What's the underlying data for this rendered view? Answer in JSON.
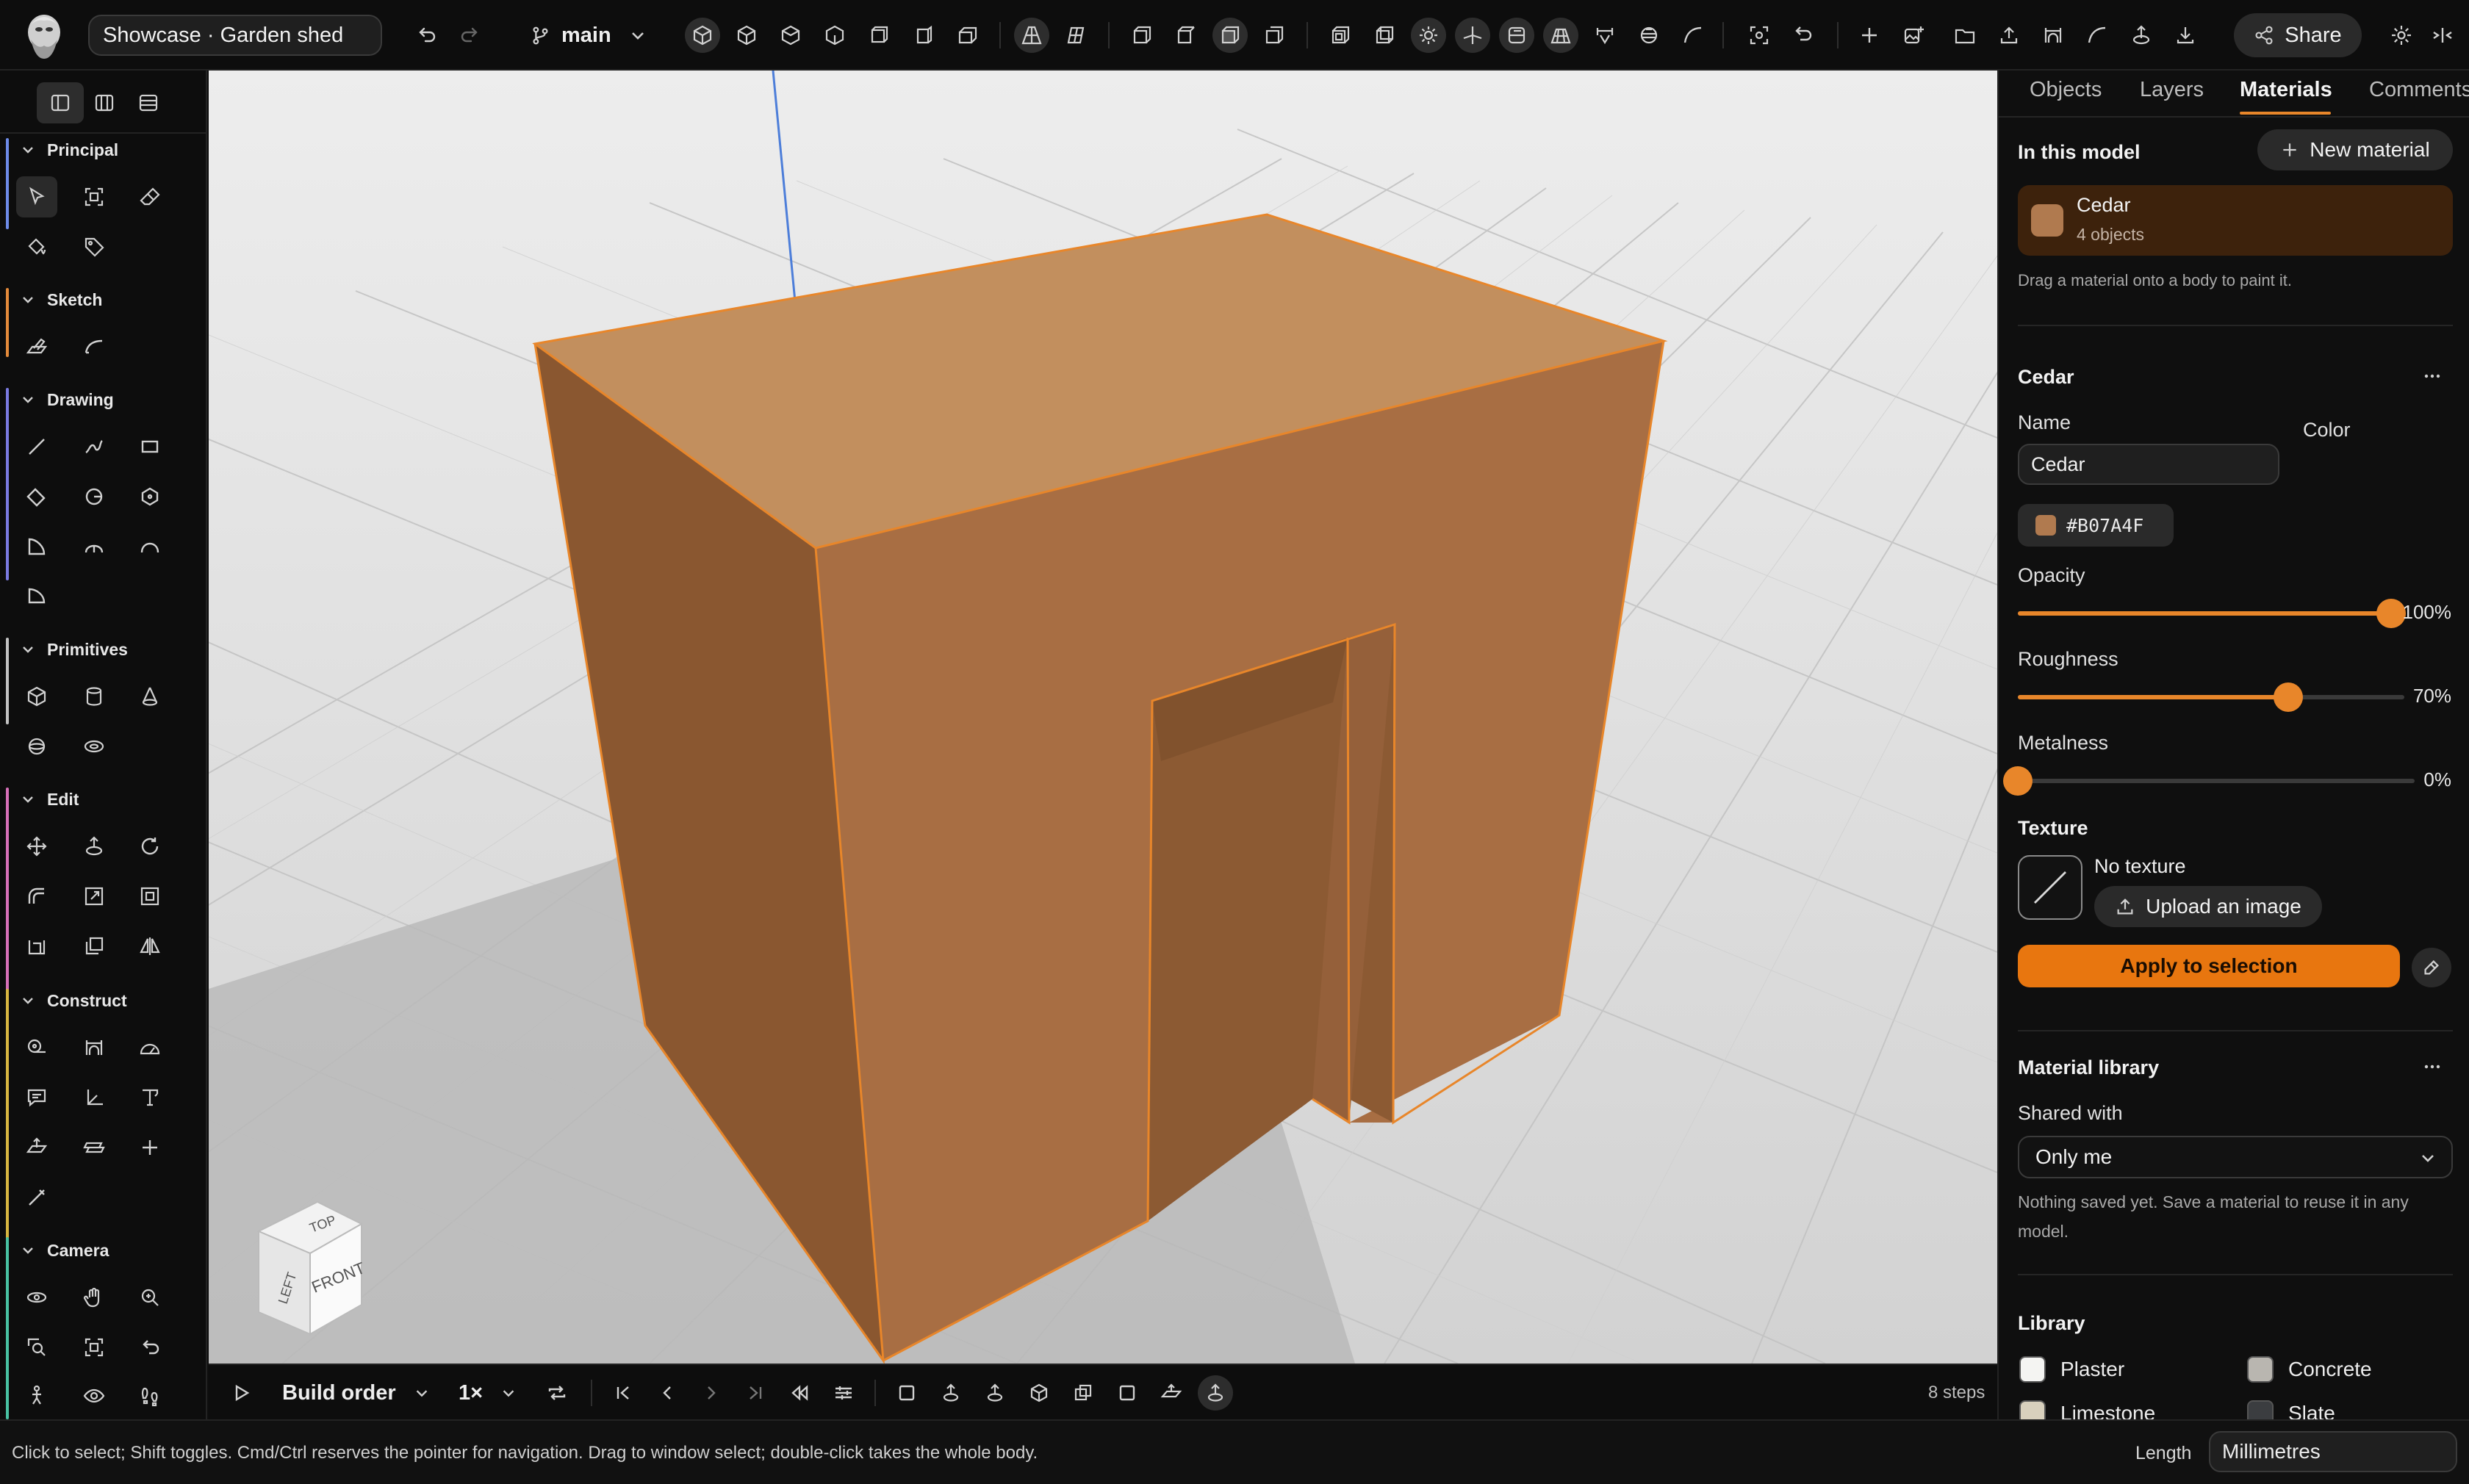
{
  "project": {
    "name": "Showcase · Garden shed"
  },
  "branch": {
    "name": "main"
  },
  "share": {
    "label": "Share"
  },
  "left_sections": {
    "principal": "Principal",
    "sketch": "Sketch",
    "drawing": "Drawing",
    "primitives": "Primitives",
    "edit": "Edit",
    "construct": "Construct",
    "camera": "Camera"
  },
  "viewcube": {
    "top": "TOP",
    "front": "FRONT",
    "left": "LEFT"
  },
  "timeline": {
    "label": "Build order",
    "speed": "1×",
    "steps": "8 steps"
  },
  "status": {
    "hint": "Click to select; Shift toggles. Cmd/Ctrl reserves the pointer for navigation. Drag to window select; double-click takes the whole body.",
    "length_label": "Length",
    "length_value": "Millimetres"
  },
  "panel": {
    "tabs": [
      "Objects",
      "Layers",
      "Materials",
      "Comments"
    ],
    "in_model": {
      "heading": "In this model",
      "new_button": "New material"
    },
    "material_card": {
      "name": "Cedar",
      "count": "4 objects"
    },
    "drag_hint": "Drag a material onto a body to paint it.",
    "editor": {
      "heading": "Cedar",
      "name_label": "Name",
      "color_label": "Color",
      "name_value": "Cedar",
      "hex": "#B07A4F",
      "opacity": {
        "label": "Opacity",
        "value": "100%",
        "level": 1.0
      },
      "roughness": {
        "label": "Roughness",
        "value": "70%",
        "level": 0.7
      },
      "metalness": {
        "label": "Metalness",
        "value": "0%",
        "level": 0.0
      },
      "texture_heading": "Texture",
      "texture_none": "No texture",
      "upload_button": "Upload an image",
      "apply_button": "Apply to selection"
    },
    "library_section": {
      "heading": "Material library",
      "shared_label": "Shared with",
      "shared_value": "Only me",
      "empty_text": "Nothing saved yet. Save a material to reuse it in any model."
    },
    "library": {
      "heading": "Library",
      "items": [
        {
          "name": "Plaster",
          "color": "#f4f4f2"
        },
        {
          "name": "Concrete",
          "color": "#b9b6b0"
        },
        {
          "name": "Limestone",
          "color": "#d8d0bd"
        },
        {
          "name": "Slate",
          "color": "#3b3d40"
        }
      ]
    }
  },
  "colors": {
    "accent": "#e8862a",
    "material": "#B07A4F"
  }
}
